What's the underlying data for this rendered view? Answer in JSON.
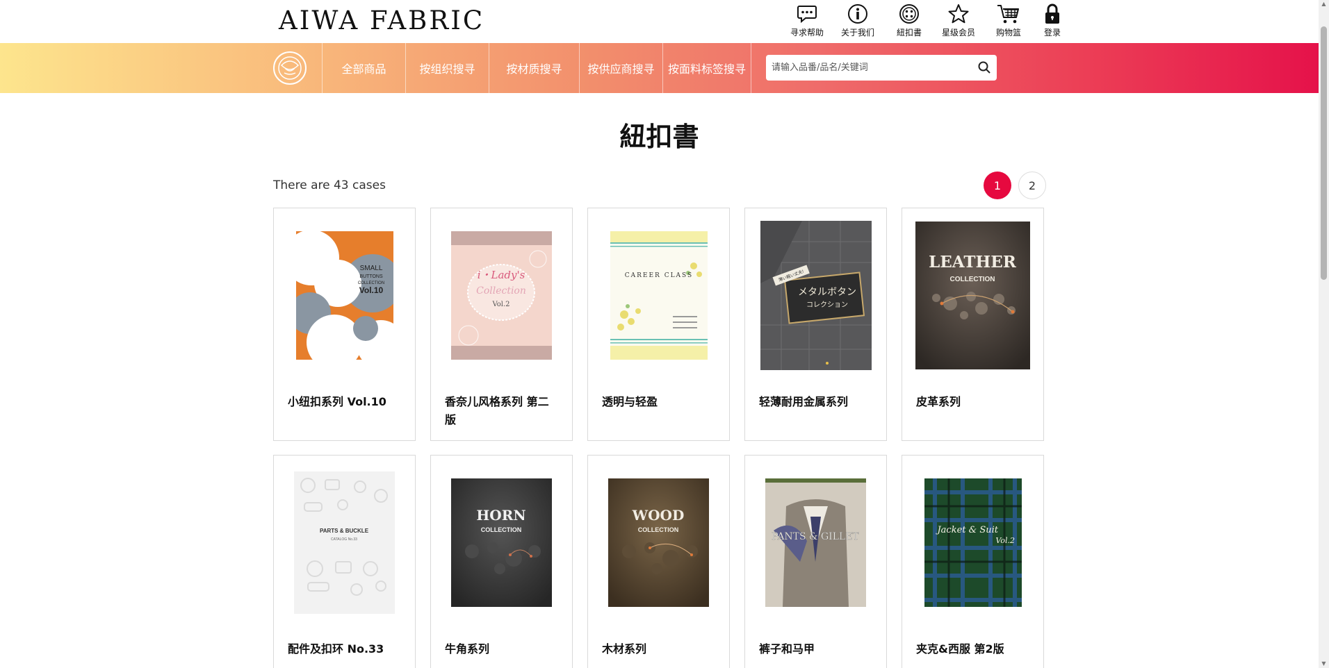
{
  "header": {
    "logo": "AIWA FABRIC",
    "icons": [
      {
        "label": "寻求帮助",
        "icon": "chat-help-icon"
      },
      {
        "label": "关于我们",
        "icon": "info-icon"
      },
      {
        "label": "紐扣書",
        "icon": "button-icon"
      },
      {
        "label": "星级会员",
        "icon": "star-icon"
      },
      {
        "label": "购物篮",
        "icon": "cart-icon"
      },
      {
        "label": "登录",
        "icon": "lock-icon"
      }
    ]
  },
  "nav": {
    "items": [
      "全部商品",
      "按组织搜寻",
      "按材质搜寻",
      "按供应商搜寻",
      "按面料标签搜寻"
    ],
    "search_placeholder": "请输入品番/品名/关键词"
  },
  "main": {
    "title": "紐扣書",
    "case_count": "There are 43 cases",
    "pages": [
      "1",
      "2"
    ],
    "active_page": "1"
  },
  "catalogs": [
    {
      "name": "小纽扣系列 Vol.10",
      "cover_text": [
        "SMALL",
        "BUTTONS",
        "COLLECTION",
        "Vol.10"
      ]
    },
    {
      "name": "香奈儿风格系列 第二版",
      "cover_text": [
        "i・Lady's",
        "Collection",
        "Vol.2"
      ]
    },
    {
      "name": "透明与轻盈",
      "cover_text": [
        "CAREER CLASS"
      ]
    },
    {
      "name": "轻薄耐用金属系列",
      "cover_text": [
        "薄い軽い丈夫!",
        "メタルボタン",
        "コレクション"
      ]
    },
    {
      "name": "皮革系列",
      "cover_text": [
        "LEATHER",
        "COLLECTION"
      ]
    },
    {
      "name": "配件及扣环 No.33",
      "cover_text": [
        "PARTS & BUCKLE",
        "CATALOG No.33"
      ]
    },
    {
      "name": "牛角系列",
      "cover_text": [
        "HORN",
        "COLLECTION"
      ]
    },
    {
      "name": "木材系列",
      "cover_text": [
        "WOOD",
        "COLLECTION"
      ]
    },
    {
      "name": "裤子和马甲",
      "cover_text": [
        "PANTS & GILLET"
      ]
    },
    {
      "name": "夹克&西服 第2版",
      "cover_text": [
        "Jacket & Suit",
        "Vol.2"
      ]
    }
  ],
  "colors": {
    "accent": "#e6093f",
    "nav_gradient_start": "#fde58d",
    "nav_gradient_end": "#e5124a"
  }
}
